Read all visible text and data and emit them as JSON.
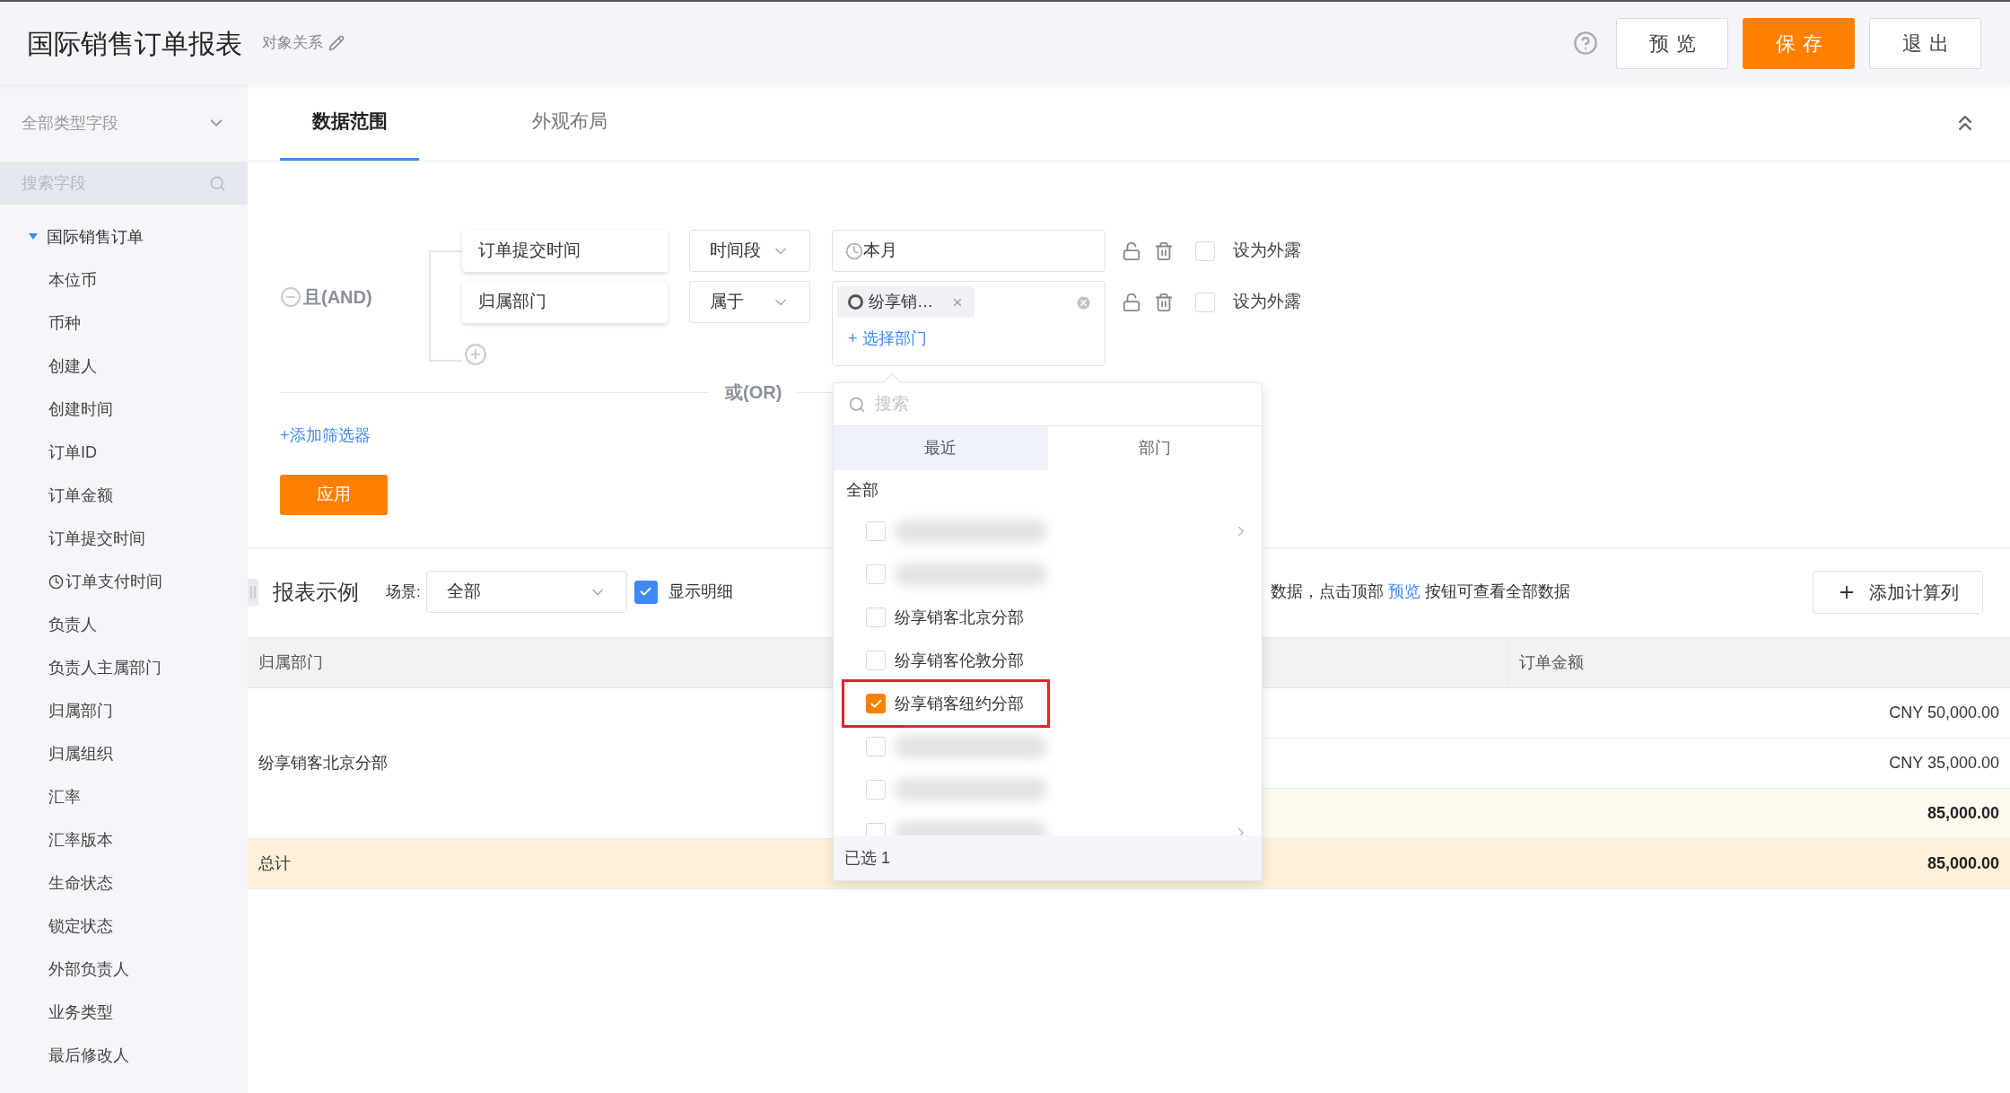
{
  "header": {
    "title": "国际销售订单报表",
    "subtitle": "对象关系",
    "buttons": [
      {
        "label": "预览",
        "kind": "default"
      },
      {
        "label": "保存",
        "kind": "primary"
      },
      {
        "label": "退出",
        "kind": "default"
      }
    ]
  },
  "sidebar": {
    "type_filter": "全部类型字段",
    "search_placeholder": "搜索字段",
    "tree": [
      {
        "label": "国际销售订单",
        "expanded": true,
        "children": [
          {
            "label": "本位币",
            "kind": "field"
          },
          {
            "label": "币种",
            "kind": "field"
          },
          {
            "label": "创建人",
            "kind": "field"
          },
          {
            "label": "创建时间",
            "kind": "field"
          },
          {
            "label": "订单ID",
            "kind": "field"
          },
          {
            "label": "订单金额",
            "kind": "field"
          },
          {
            "label": "订单提交时间",
            "kind": "field"
          },
          {
            "label": "订单支付时间",
            "kind": "time"
          },
          {
            "label": "负责人",
            "kind": "field"
          },
          {
            "label": "负责人主属部门",
            "kind": "field"
          },
          {
            "label": "归属部门",
            "kind": "field"
          },
          {
            "label": "归属组织",
            "kind": "field"
          },
          {
            "label": "汇率",
            "kind": "field"
          },
          {
            "label": "汇率版本",
            "kind": "field"
          },
          {
            "label": "生命状态",
            "kind": "field"
          },
          {
            "label": "锁定状态",
            "kind": "field"
          },
          {
            "label": "外部负责人",
            "kind": "field"
          },
          {
            "label": "业务类型",
            "kind": "field"
          },
          {
            "label": "最后修改人",
            "kind": "field"
          }
        ]
      }
    ]
  },
  "tabs": [
    {
      "label": "数据范围",
      "selected": true
    },
    {
      "label": "外观布局",
      "selected": false
    }
  ],
  "filter": {
    "group_label": "且(AND)",
    "conditions": [
      {
        "field": "订单提交时间",
        "operator": "时间段",
        "kind": "date",
        "value": "本月",
        "exposed": false,
        "expose_label": "设为外露"
      },
      {
        "field": "归属部门",
        "operator": "属于",
        "kind": "dept",
        "tags": [
          "纷享销…"
        ],
        "add_link": "+ 选择部门",
        "exposed": false,
        "expose_label": "设为外露"
      }
    ],
    "or_label": "或(OR)",
    "add_filter": "+添加筛选器",
    "apply": "应用"
  },
  "report": {
    "title": "报表示例",
    "scene_label": "场景:",
    "scene_value": "全部",
    "show_detail": {
      "label": "显示明细",
      "checked": true
    },
    "hint": {
      "before": "数据，点击顶部 ",
      "link": "预览",
      "after": " 按钮可查看全部数据"
    },
    "add_column": "添加计算列"
  },
  "table": {
    "columns": [
      "归属部门",
      "订单金额"
    ],
    "groups": [
      {
        "label": "纷享销客北京分部",
        "amounts": [
          "CNY 50,000.00",
          "CNY 35,000.00"
        ],
        "subtotal": "85,000.00"
      }
    ],
    "total": {
      "label": "总计",
      "amount": "85,000.00"
    }
  },
  "popup": {
    "search_placeholder": "搜索",
    "tabs": [
      {
        "label": "最近",
        "selected": true
      },
      {
        "label": "部门",
        "selected": false
      }
    ],
    "section": "全部",
    "items": [
      {
        "kind": "redacted",
        "checked": false,
        "highlighted": false,
        "has_children": true
      },
      {
        "kind": "redacted",
        "checked": false,
        "highlighted": false,
        "has_children": false
      },
      {
        "kind": "dept",
        "label": "纷享销客北京分部",
        "checked": false,
        "highlighted": false,
        "has_children": false
      },
      {
        "kind": "dept",
        "label": "纷享销客伦敦分部",
        "checked": false,
        "highlighted": false,
        "has_children": false
      },
      {
        "kind": "dept",
        "label": "纷享销客纽约分部",
        "checked": true,
        "highlighted": true,
        "has_children": false
      },
      {
        "kind": "redacted",
        "checked": false,
        "highlighted": false,
        "has_children": false
      },
      {
        "kind": "redacted",
        "checked": false,
        "highlighted": false,
        "has_children": false
      },
      {
        "kind": "redacted",
        "checked": false,
        "highlighted": false,
        "has_children": true
      }
    ],
    "footer": "已选 1"
  }
}
